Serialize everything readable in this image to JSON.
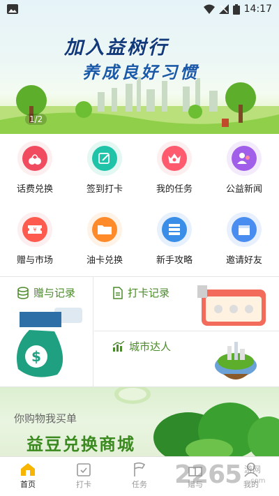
{
  "status_bar": {
    "time": "14:17"
  },
  "banner": {
    "title_line1": "加入益树行",
    "title_line2": "养成良好习惯",
    "page_indicator": "1/2"
  },
  "grid": {
    "items": [
      {
        "label": "话费兑换",
        "icon": "cherry-icon",
        "color": "#f14b60"
      },
      {
        "label": "签到打卡",
        "icon": "edit-icon",
        "color": "#1fc3a7"
      },
      {
        "label": "我的任务",
        "icon": "crown-icon",
        "color": "#ff5a6e"
      },
      {
        "label": "公益新闻",
        "icon": "users-icon",
        "color": "#a15ee8"
      },
      {
        "label": "赠与市场",
        "icon": "ticket-icon",
        "color": "#ff5a4e"
      },
      {
        "label": "油卡兑换",
        "icon": "folder-icon",
        "color": "#ff8a2a"
      },
      {
        "label": "新手攻略",
        "icon": "server-icon",
        "color": "#3a8ee8"
      },
      {
        "label": "邀请好友",
        "icon": "box-icon",
        "color": "#4a8df0"
      }
    ]
  },
  "records": {
    "gift_record": "赠与记录",
    "checkin_record": "打卡记录",
    "city_expert": "城市达人"
  },
  "shop_banner": {
    "subtitle": "你购物我买单",
    "title": "益豆兑换商城"
  },
  "tabs": [
    {
      "label": "首页",
      "icon": "home-icon",
      "active": true
    },
    {
      "label": "打卡",
      "icon": "calendar-check-icon",
      "active": false
    },
    {
      "label": "任务",
      "icon": "flag-icon",
      "active": false
    },
    {
      "label": "赠与",
      "icon": "gift-icon",
      "active": false
    },
    {
      "label": "我的",
      "icon": "user-icon",
      "active": false
    }
  ],
  "watermark": {
    "text": "2265",
    "suffix": ".com",
    "site": "游网"
  },
  "colors": {
    "accent_green": "#4b8a2a",
    "tab_active": "#f7b500"
  }
}
